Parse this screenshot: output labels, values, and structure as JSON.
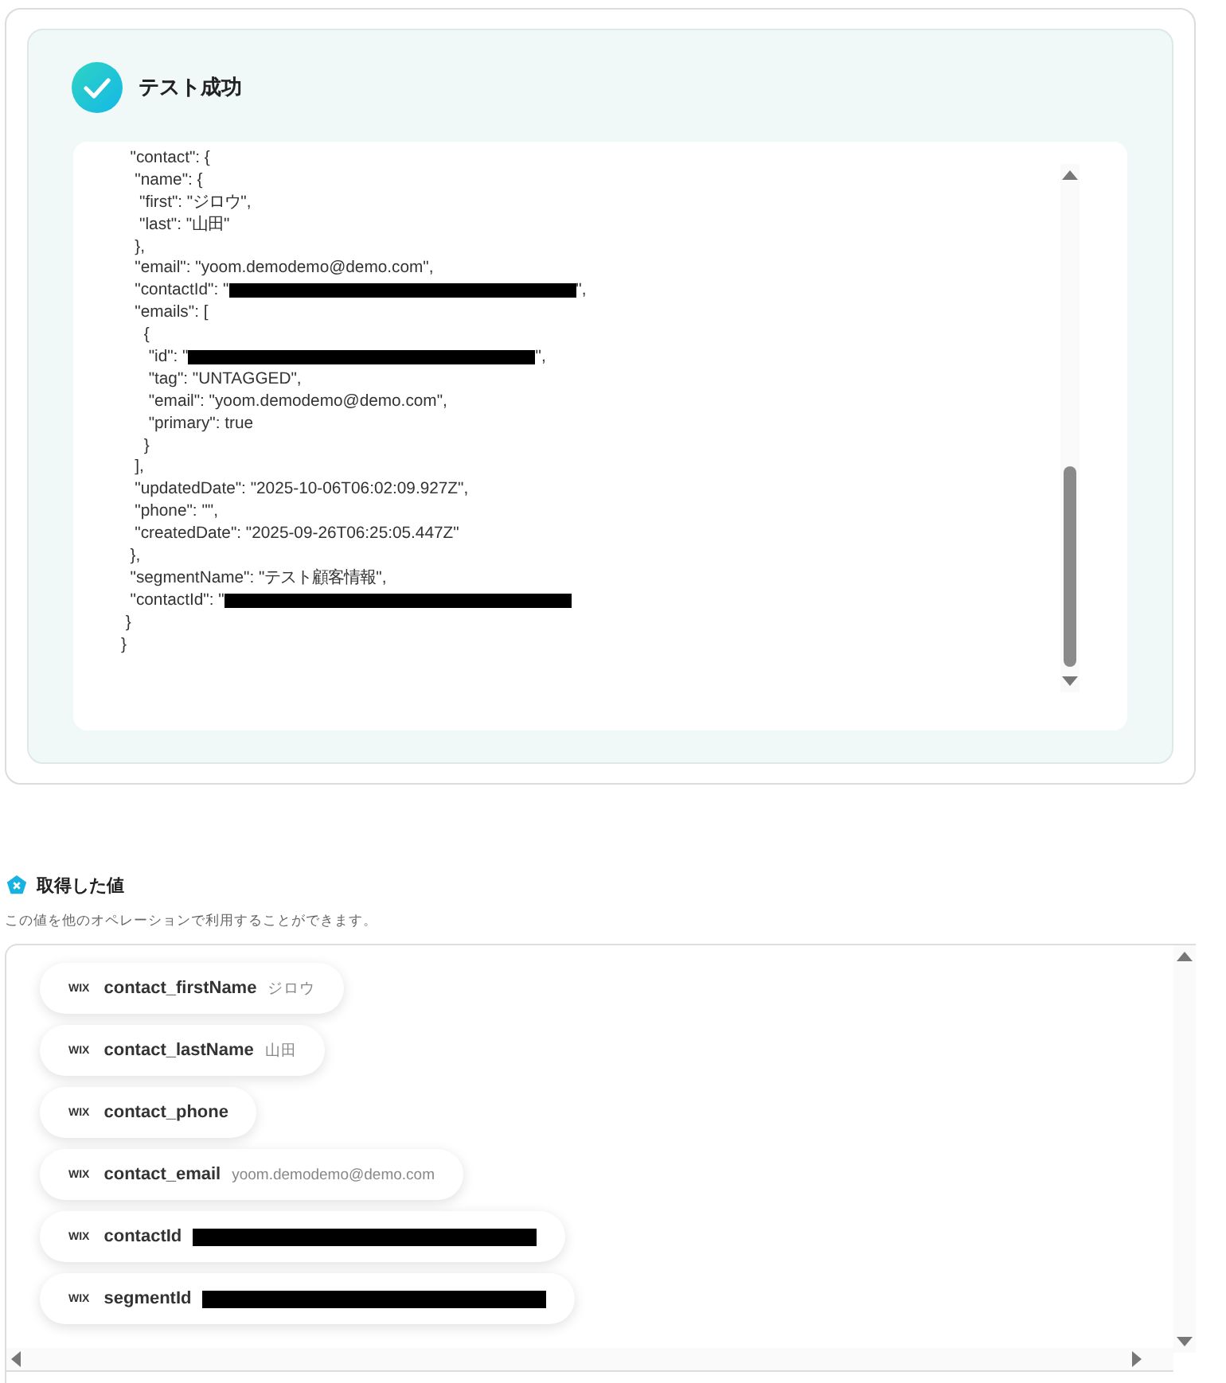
{
  "result": {
    "title": "テスト成功",
    "success": true,
    "code_lines": [
      {
        "text": "  \"contact\": {"
      },
      {
        "text": "   \"name\": {"
      },
      {
        "text": "    \"first\": \"ジロウ\","
      },
      {
        "text": "    \"last\": \"山田\""
      },
      {
        "text": "   },"
      },
      {
        "text": "   \"email\": \"yoom.demodemo@demo.com\","
      },
      {
        "text": "   \"contactId\": \"",
        "redacted": true,
        "suffix": "\","
      },
      {
        "text": "   \"emails\": ["
      },
      {
        "text": "     {"
      },
      {
        "text": "      \"id\": \"",
        "redacted": true,
        "suffix": "\","
      },
      {
        "text": "      \"tag\": \"UNTAGGED\","
      },
      {
        "text": "      \"email\": \"yoom.demodemo@demo.com\","
      },
      {
        "text": "      \"primary\": true"
      },
      {
        "text": "     }"
      },
      {
        "text": "   ],"
      },
      {
        "text": "   \"updatedDate\": \"2025-10-06T06:02:09.927Z\","
      },
      {
        "text": "   \"phone\": \"\","
      },
      {
        "text": "   \"createdDate\": \"2025-09-26T06:25:05.447Z\""
      },
      {
        "text": "  },"
      },
      {
        "text": "  \"segmentName\": \"テスト顧客情報\","
      },
      {
        "text": "  \"contactId\": \"",
        "redacted": true
      },
      {
        "text": " }"
      },
      {
        "text": "}"
      }
    ]
  },
  "outputs": {
    "title": "取得した値",
    "subtitle": "この値を他のオペレーションで利用することができます。",
    "items": [
      {
        "source": "WIX",
        "name": "contact_firstName",
        "value": "ジロウ"
      },
      {
        "source": "WIX",
        "name": "contact_lastName",
        "value": "山田"
      },
      {
        "source": "WIX",
        "name": "contact_phone"
      },
      {
        "source": "WIX",
        "name": "contact_email",
        "value": "yoom.demodemo@demo.com"
      },
      {
        "source": "WIX",
        "name": "contactId",
        "redacted": true
      },
      {
        "source": "WIX",
        "name": "segmentId",
        "redacted": true
      }
    ]
  }
}
